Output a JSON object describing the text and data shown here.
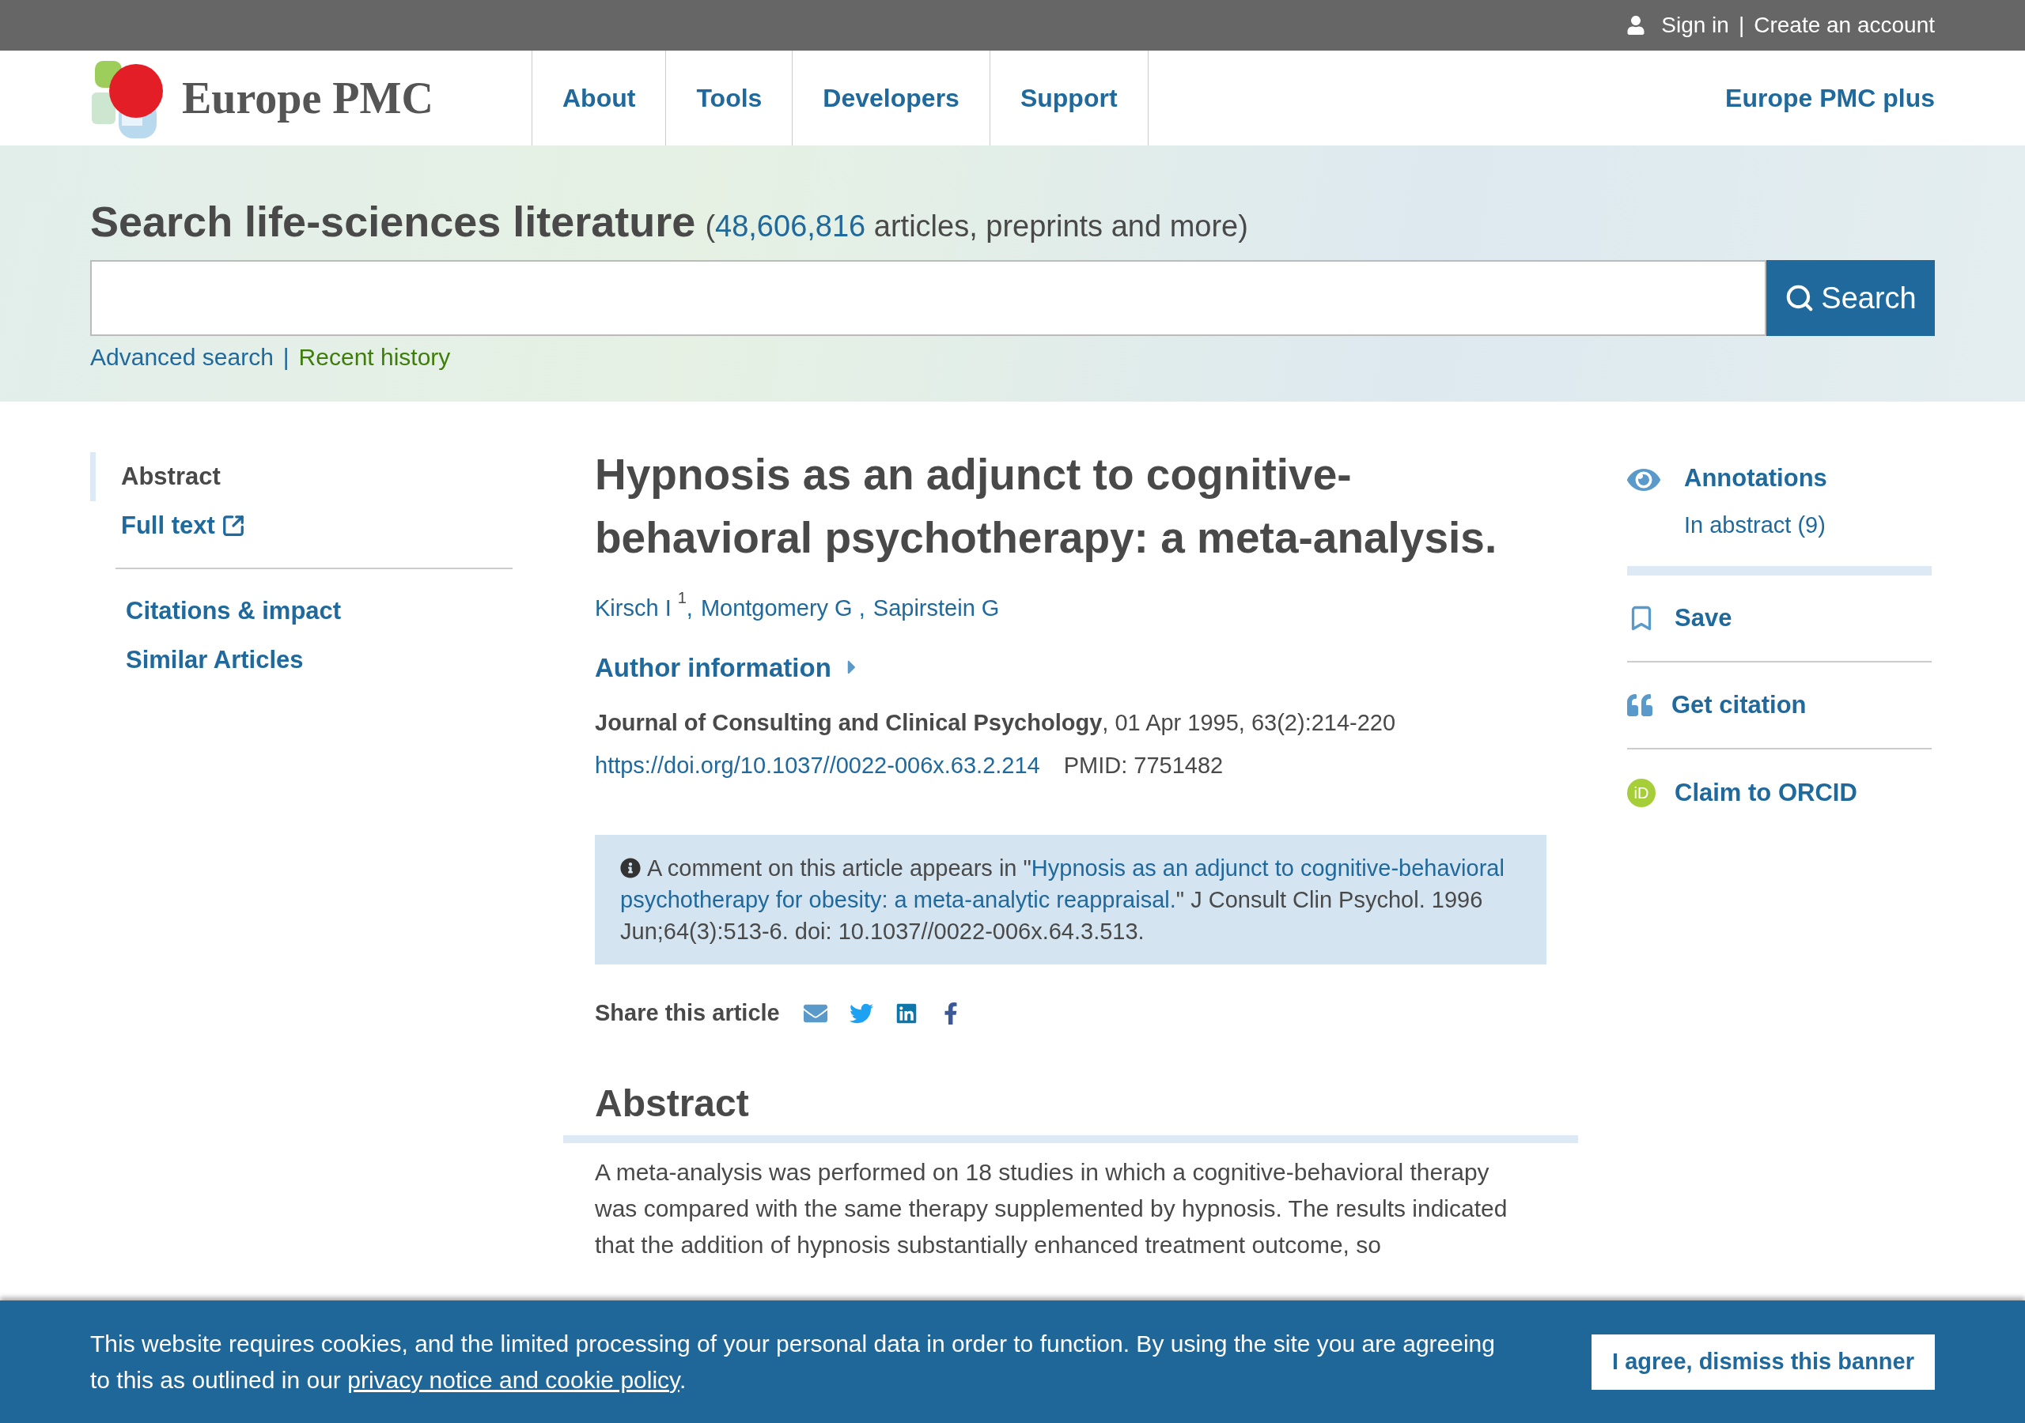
{
  "top_bar": {
    "sign_in": "Sign in",
    "separator": "|",
    "create_account": "Create an account"
  },
  "header": {
    "logo_text": "Europe PMC",
    "nav": [
      {
        "label": "About"
      },
      {
        "label": "Tools"
      },
      {
        "label": "Developers"
      },
      {
        "label": "Support"
      }
    ],
    "plus_link": "Europe PMC plus"
  },
  "search": {
    "heading": "Search life-sciences literature",
    "count_open": "(",
    "count": "48,606,816",
    "count_rest": "articles, preprints and more)",
    "button": "Search",
    "advanced": "Advanced search",
    "separator": "|",
    "recent": "Recent history"
  },
  "side_nav": {
    "sections": [
      {
        "items": [
          {
            "label": "Abstract",
            "selected": true,
            "external": false
          },
          {
            "label": "Full text",
            "selected": false,
            "external": true
          }
        ]
      },
      {
        "items": [
          {
            "label": "Citations & impact",
            "selected": false,
            "external": false
          },
          {
            "label": "Similar Articles",
            "selected": false,
            "external": false
          }
        ]
      }
    ]
  },
  "article": {
    "title": "Hypnosis as an adjunct to cognitive-behavioral psychotherapy: a meta-analysis.",
    "authors": [
      {
        "name": "Kirsch I",
        "sup": "1",
        "suffix": ","
      },
      {
        "name": "Montgomery G",
        "suffix": " ,"
      },
      {
        "name": "Sapirstein G"
      }
    ],
    "author_info": {
      "label": "Author information",
      "expanded": false
    },
    "journal": {
      "name": "Journal of Consulting and Clinical Psychology",
      "details": ", 01 Apr 1995, 63(2):214-220"
    },
    "doi": "https://doi.org/10.1037//0022-006x.63.2.214",
    "pmid": "PMID: 7751482",
    "comment": {
      "prefix": "A comment on this article appears in \"",
      "link_lines": [
        "Hypnosis as an adjunct to cognitive-behavioral",
        "psychotherapy for obesity: a meta-analytic reappraisal."
      ],
      "suffix": "\" J Consult Clin Psychol. 1996 Jun;64(3):513-6. doi: 10.1037//0022-006x.64.3.513."
    },
    "share": {
      "label": "Share this article",
      "buttons": [
        {
          "kind": "email"
        },
        {
          "kind": "twitter"
        },
        {
          "kind": "linkedin"
        },
        {
          "kind": "facebook"
        }
      ]
    },
    "abstract": {
      "heading": "Abstract",
      "text": "A meta-analysis was performed on 18 studies in which a cognitive-behavioral therapy was compared with the same therapy supplemented by hypnosis. The results indicated that the addition of hypnosis substantially enhanced treatment outcome, so"
    }
  },
  "right_panel": {
    "annotations": {
      "label": "Annotations",
      "sub": "In abstract (9)"
    },
    "actions": [
      {
        "kind": "save",
        "label": "Save"
      },
      {
        "kind": "citation",
        "label": "Get citation"
      },
      {
        "kind": "orcid",
        "label": "Claim to ORCID",
        "badge": "iD"
      }
    ]
  },
  "cookie_banner": {
    "text": "This website requires cookies, and the limited processing of your personal data in order to function. By using the site you are agreeing to this as outlined in our ",
    "link": "privacy notice and cookie policy",
    "end": ".",
    "button": "I agree, dismiss this banner"
  }
}
